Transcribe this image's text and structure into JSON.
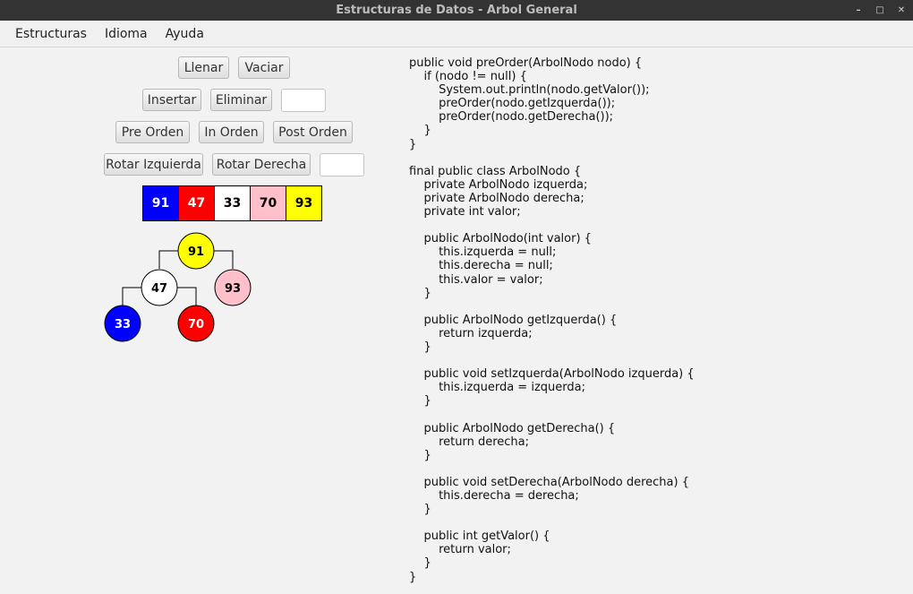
{
  "window": {
    "title": "Estructuras de Datos - Arbol General"
  },
  "menu": [
    "Estructuras",
    "Idioma",
    "Ayuda"
  ],
  "buttons": {
    "llenar": "Llenar",
    "vaciar": "Vaciar",
    "insertar": "Insertar",
    "eliminar": "Eliminar",
    "pre_orden": "Pre Orden",
    "in_orden": "In Orden",
    "post_orden": "Post Orden",
    "rotar_izquierda": "Rotar Izquierda",
    "rotar_derecha": "Rotar Derecha"
  },
  "inputs": {
    "eliminar_value": "",
    "rotar_value": ""
  },
  "traversal": [
    {
      "value": "91",
      "bg": "#0000ff",
      "fg": "#ffffff"
    },
    {
      "value": "47",
      "bg": "#ff0000",
      "fg": "#ffffff"
    },
    {
      "value": "33",
      "bg": "#ffffff",
      "fg": "#000000"
    },
    {
      "value": "70",
      "bg": "#ffc0cb",
      "fg": "#000000"
    },
    {
      "value": "93",
      "bg": "#ffff00",
      "fg": "#000000"
    }
  ],
  "tree": {
    "root": {
      "value": "91",
      "color": "#ffff00",
      "text": "#000000"
    },
    "nodes": [
      {
        "id": "n91",
        "value": "91",
        "color": "#ffff00",
        "text": "#000000"
      },
      {
        "id": "n47",
        "value": "47",
        "color": "#ffffff",
        "text": "#000000"
      },
      {
        "id": "n93",
        "value": "93",
        "color": "#ffc0cb",
        "text": "#000000"
      },
      {
        "id": "n33",
        "value": "33",
        "color": "#0000ff",
        "text": "#ffffff"
      },
      {
        "id": "n70",
        "value": "70",
        "color": "#ff0000",
        "text": "#ffffff"
      }
    ]
  },
  "code": [
    "public void preOrder(ArbolNodo nodo) {",
    "\tif (nodo != null) {",
    "\t\tSystem.out.println(nodo.getValor());",
    "\t\tpreOrder(nodo.getIzquerda());",
    "\t\tpreOrder(nodo.getDerecha());",
    "\t}",
    "}",
    "",
    "final public class ArbolNodo {",
    "\tprivate ArbolNodo izquerda;",
    "\tprivate ArbolNodo derecha;",
    "\tprivate int valor;",
    "",
    "\tpublic ArbolNodo(int valor) {",
    "\t\tthis.izquerda = null;",
    "\t\tthis.derecha = null;",
    "\t\tthis.valor = valor;",
    "\t}",
    "",
    "\tpublic ArbolNodo getIzquerda() {",
    "\t\treturn izquerda;",
    "\t}",
    "",
    "\tpublic void setIzquerda(ArbolNodo izquerda) {",
    "\t\tthis.izquerda = izquerda;",
    "\t}",
    "",
    "\tpublic ArbolNodo getDerecha() {",
    "\t\treturn derecha;",
    "\t}",
    "",
    "\tpublic void setDerecha(ArbolNodo derecha) {",
    "\t\tthis.derecha = derecha;",
    "\t}",
    "",
    "\tpublic int getValor() {",
    "\t\treturn valor;",
    "\t}",
    "}"
  ]
}
